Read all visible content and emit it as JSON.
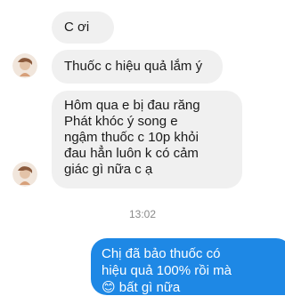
{
  "messages": {
    "m1": "C ơi",
    "m2": "Thuốc c hiệu quả lắm ý",
    "m3": {
      "lines": [
        "Hôm qua e bị đau răng",
        "Phát khóc ý song e",
        "ngậm thuốc c 10p khỏi",
        "đau hẳn luôn k có cảm",
        "giác gì nữa c ạ"
      ]
    },
    "timestamp": "13:02",
    "outgoing": {
      "lines": [
        "Chị đã bảo thuốc có",
        "hiệu quả 100% rồi mà",
        "😊 bất gì nữa"
      ]
    }
  },
  "colors": {
    "incoming_bg": "#f0f0f0",
    "outgoing_bg": "#1e88e5",
    "timestamp": "#8a8a8a"
  },
  "icons": {
    "avatar": "avatar-icon"
  }
}
